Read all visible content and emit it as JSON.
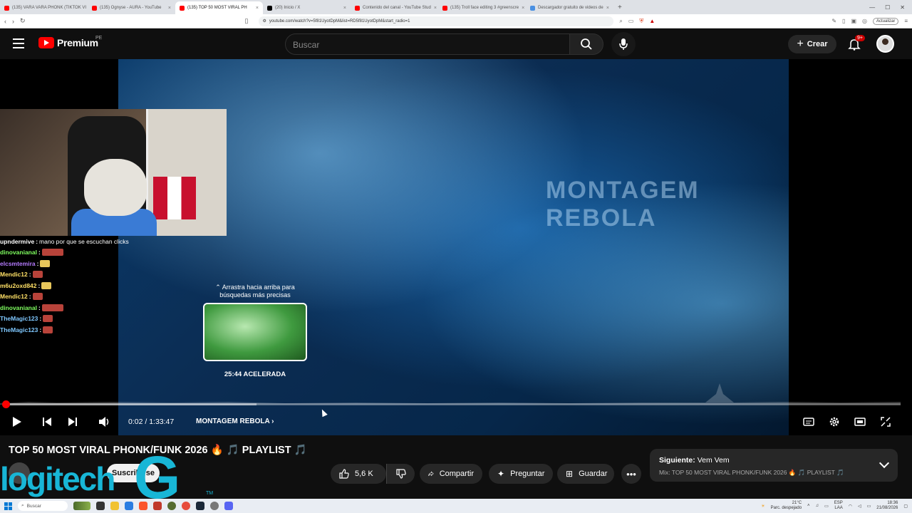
{
  "browser": {
    "tabs": [
      {
        "label": "(135) VARA VARA PHONK (TIKTOK VI",
        "fav_color": "#ff0000",
        "active": false
      },
      {
        "label": "(135) Ognyse - AURA - YouTube",
        "fav_color": "#ff0000",
        "active": false
      },
      {
        "label": "(135) TOP 50 MOST VIRAL PH",
        "fav_color": "#ff0000",
        "active": true
      },
      {
        "label": "(20) Inicio / X",
        "fav_color": "#000000",
        "active": false
      },
      {
        "label": "Contenido del canal - YouTube Stud",
        "fav_color": "#ff0000",
        "active": false
      },
      {
        "label": "(135) Troll face editing 3 #greenscre",
        "fav_color": "#ff0000",
        "active": false
      },
      {
        "label": "Descargador gratuito de videos de",
        "fav_color": "#4a90e2",
        "active": false
      }
    ],
    "url": "youtube.com/watch?v=5f81UyotDpM&list=RD5f81UyotDpM&start_radio=1",
    "update_label": "Actualizar"
  },
  "header": {
    "brand": "Premium",
    "country": "PE",
    "search_placeholder": "Buscar",
    "create_label": "Crear",
    "notification_count": "9+"
  },
  "player": {
    "watermark": "MONTAGEM REBOLA",
    "hint": "⌃ Arrastra hacia arriba para búsquedas más precisas",
    "preview_label": "25:44  ACELERADA",
    "time": "0:02 / 1:33:47",
    "chapter": "MONTAGEM REBOLA",
    "progress_fraction": 0.0004
  },
  "chat": [
    {
      "user": "upndermive",
      "color": "#ffffff",
      "text": "mano por que se escuchan clicks",
      "emote": ""
    },
    {
      "user": "dinovanianal",
      "color": "#7fff5f",
      "text": "",
      "emote": "wide"
    },
    {
      "user": "elcsmtemira",
      "color": "#b57bff",
      "text": "",
      "emote": "yellow"
    },
    {
      "user": "Mendic12",
      "color": "#ffe066",
      "text": "",
      "emote": "red"
    },
    {
      "user": "m6u2oxd842",
      "color": "#ffe066",
      "text": "",
      "emote": "yellow"
    },
    {
      "user": "Mendic12",
      "color": "#ffe066",
      "text": "",
      "emote": "red"
    },
    {
      "user": "dinovanianal",
      "color": "#7fff5f",
      "text": "",
      "emote": "wide"
    },
    {
      "user": "TheMagic123",
      "color": "#7fc8ff",
      "text": "",
      "emote": "red"
    },
    {
      "user": "TheMagic123",
      "color": "#7fc8ff",
      "text": "",
      "emote": "red"
    }
  ],
  "video": {
    "title": "TOP 50 MOST VIRAL PHONK/FUNK 2026 🔥 🎵 PLAYLIST 🎵",
    "subscribe_label": "Suscribirse",
    "overlay_logo": "logitech",
    "overlay_g": "G",
    "overlay_tm": "TM",
    "likes": "5,6 K",
    "share_label": "Compartir",
    "ask_label": "Preguntar",
    "save_label": "Guardar"
  },
  "up_next": {
    "prefix": "Siguiente:",
    "title": "Vem Vem",
    "mix": "Mix: TOP 50 MOST VIRAL PHONK/FUNK 2026 🔥 🎵 PLAYLIST 🎵"
  },
  "taskbar": {
    "search_label": "Buscar",
    "weather": "21°C",
    "weather_desc": "Parc. despejado",
    "lang": "ESP",
    "lang_sub": "LAA",
    "time": "18:36",
    "date": "21/08/2026"
  }
}
